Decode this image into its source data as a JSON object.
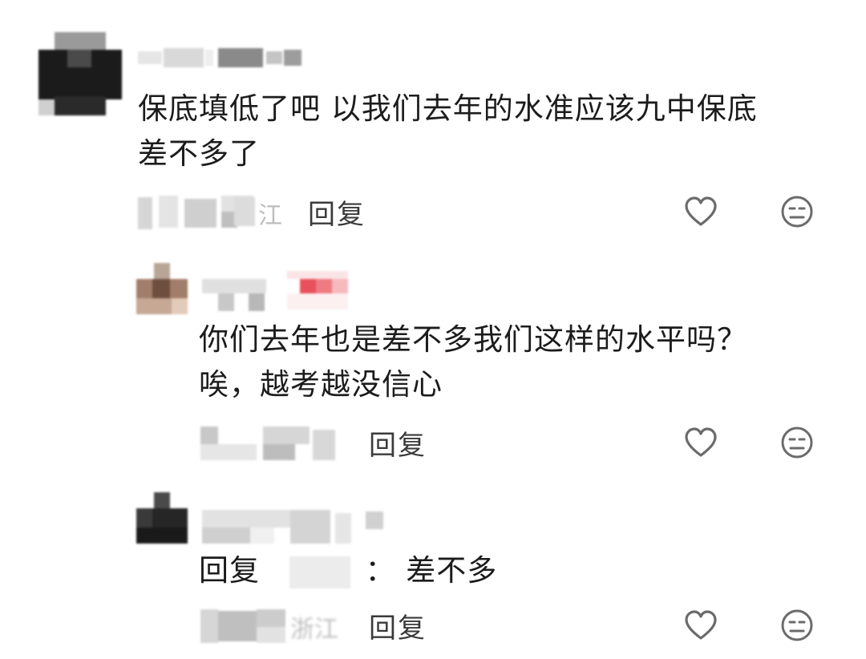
{
  "comments": [
    {
      "username": "",
      "content_line1": "保底填低了吧 以我们去年的水准应该九中保底",
      "content_line2": "差不多了",
      "location": "江",
      "reply_label": "回复",
      "replies": [
        {
          "username": "",
          "content_line1": "你们去年也是差不多我们这样的水平吗？",
          "content_line2": "唉，越考越没信心",
          "location": "",
          "reply_label": "回复"
        },
        {
          "username": "",
          "reply_prefix": "回复",
          "reply_separator": "：",
          "content": "差不多",
          "location": "浙江",
          "reply_label": "回复"
        }
      ]
    }
  ],
  "icons": {
    "like": "heart-icon",
    "dislike": "unamused-face-icon"
  },
  "colors": {
    "text": "#1c1c1c",
    "secondary": "#3a3a3a",
    "icon": "#6b6b6b",
    "badge": "#e8505b"
  }
}
